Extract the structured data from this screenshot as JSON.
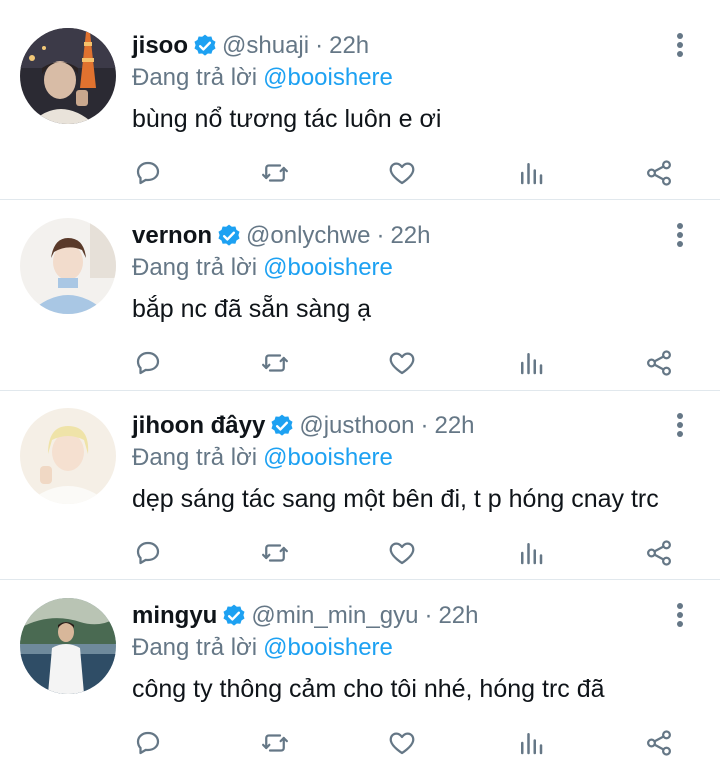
{
  "colors": {
    "accent": "#1da1f2",
    "verified": "#1da1f2",
    "secondary_text": "#657786",
    "divider": "#e1e8ed"
  },
  "reply_prefix": "Đang trả lời",
  "tweets": [
    {
      "name": "jisoo",
      "handle": "@shuaji",
      "separator": "·",
      "time": "22h",
      "reply_to": "@booishere",
      "text": "bùng nổ tương tác luôn e ơi",
      "avatar": "jisoo-avatar"
    },
    {
      "name": "vernon",
      "handle": "@onlychwe",
      "separator": "·",
      "time": "22h",
      "reply_to": "@booishere",
      "text": "bắp nc đã sẵn sàng ạ",
      "avatar": "vernon-avatar"
    },
    {
      "name": "jihoon đâyy",
      "handle": "@justhoon",
      "separator": "·",
      "time": "22h",
      "reply_to": "@booishere",
      "text": "dẹp sáng tác sang một bên đi, t p hóng cnay trc",
      "avatar": "jihoon-avatar"
    },
    {
      "name": "mingyu",
      "handle": "@min_min_gyu",
      "separator": "·",
      "time": "22h",
      "reply_to": "@booishere",
      "text": "công ty thông cảm cho tôi nhé, hóng trc đã",
      "avatar": "mingyu-avatar"
    }
  ],
  "action_icons": [
    "reply-icon",
    "retweet-icon",
    "like-icon",
    "analytics-icon",
    "share-icon"
  ]
}
